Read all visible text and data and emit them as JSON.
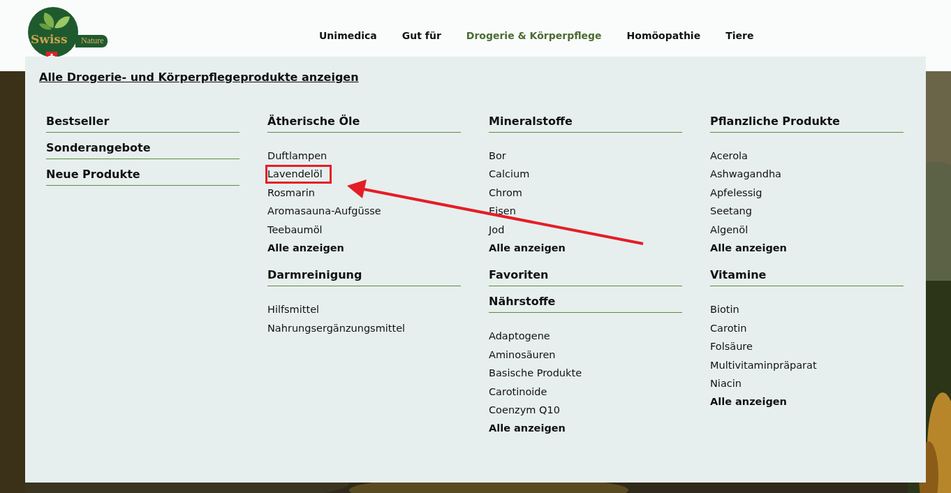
{
  "logo": {
    "word": "Swiss",
    "tag": "Nature"
  },
  "nav": [
    {
      "label": "Unimedica",
      "selected": false
    },
    {
      "label": "Gut für",
      "selected": false
    },
    {
      "label": "Drogerie & Körperpflege",
      "selected": true
    },
    {
      "label": "Homöopathie",
      "selected": false
    },
    {
      "label": "Tiere",
      "selected": false
    }
  ],
  "menu": {
    "all_link": "Alle Drogerie- und Körperpflegeprodukte anzeigen",
    "columns": [
      {
        "sections": [
          {
            "heading": "Bestseller"
          },
          {
            "heading": "Sonderangebote"
          },
          {
            "heading": "Neue Produkte"
          }
        ]
      },
      {
        "sections": [
          {
            "heading": "Ätherische Öle",
            "items": [
              {
                "label": "Duftlampen",
                "highlighted": false
              },
              {
                "label": "Lavendelöl",
                "highlighted": true
              },
              {
                "label": "Rosmarin",
                "highlighted": false
              },
              {
                "label": "Aromasauna-Aufgüsse",
                "highlighted": false
              },
              {
                "label": "Teebaumöl",
                "highlighted": false
              }
            ],
            "show_all": "Alle anzeigen"
          },
          {
            "heading": "Darmreinigung",
            "items": [
              {
                "label": "Hilfsmittel",
                "highlighted": false
              },
              {
                "label": "Nahrungsergänzungsmittel",
                "highlighted": false
              }
            ]
          }
        ]
      },
      {
        "sections": [
          {
            "heading": "Mineralstoffe",
            "items": [
              {
                "label": "Bor",
                "highlighted": false
              },
              {
                "label": "Calcium",
                "highlighted": false
              },
              {
                "label": "Chrom",
                "highlighted": false
              },
              {
                "label": "Eisen",
                "highlighted": false
              },
              {
                "label": "Jod",
                "highlighted": false
              }
            ],
            "show_all": "Alle anzeigen"
          },
          {
            "heading": "Favoriten"
          },
          {
            "heading": "Nährstoffe",
            "items": [
              {
                "label": "Adaptogene",
                "highlighted": false
              },
              {
                "label": "Aminosäuren",
                "highlighted": false
              },
              {
                "label": "Basische Produkte",
                "highlighted": false
              },
              {
                "label": "Carotinoide",
                "highlighted": false
              },
              {
                "label": "Coenzym Q10",
                "highlighted": false
              }
            ],
            "show_all": "Alle anzeigen"
          }
        ]
      },
      {
        "sections": [
          {
            "heading": "Pflanzliche Produkte",
            "items": [
              {
                "label": "Acerola",
                "highlighted": false
              },
              {
                "label": "Ashwagandha",
                "highlighted": false
              },
              {
                "label": "Apfelessig",
                "highlighted": false
              },
              {
                "label": "Seetang",
                "highlighted": false
              },
              {
                "label": "Algenöl",
                "highlighted": false
              }
            ],
            "show_all": "Alle anzeigen"
          },
          {
            "heading": "Vitamine",
            "items": [
              {
                "label": "Biotin",
                "highlighted": false
              },
              {
                "label": "Carotin",
                "highlighted": false
              },
              {
                "label": "Folsäure",
                "highlighted": false
              },
              {
                "label": "Multivitaminpräparat",
                "highlighted": false
              },
              {
                "label": "Niacin",
                "highlighted": false
              }
            ],
            "show_all": "Alle anzeigen"
          }
        ]
      }
    ]
  }
}
